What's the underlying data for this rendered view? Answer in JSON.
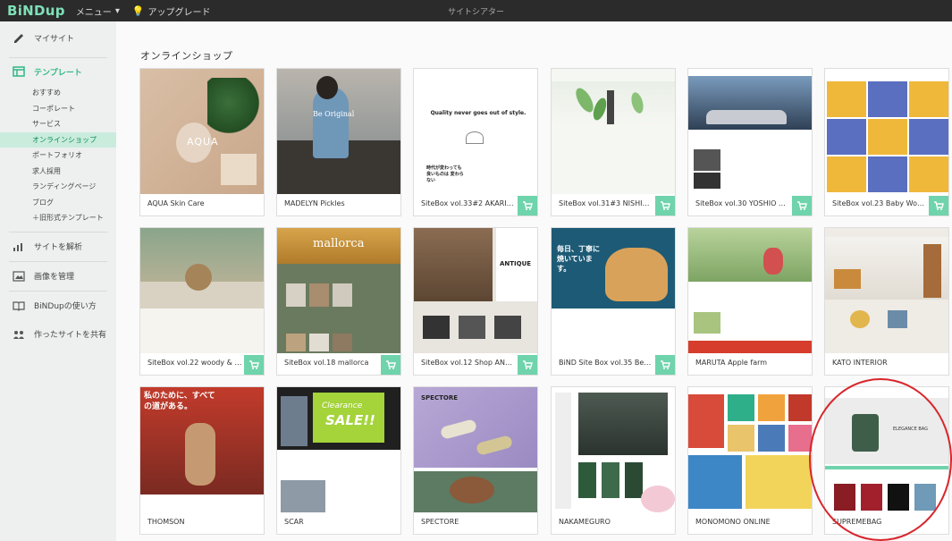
{
  "topbar": {
    "logo_main": "BiND",
    "logo_sub": "up",
    "menu_label": "メニュー",
    "upgrade_label": "アップグレード",
    "site_title": "サイトシアター"
  },
  "sidebar": {
    "items": [
      {
        "label": "マイサイト",
        "icon": "pencil-icon"
      },
      {
        "label": "テンプレート",
        "icon": "template-icon"
      },
      {
        "label": "サイトを解析",
        "icon": "chart-icon"
      },
      {
        "label": "画像を管理",
        "icon": "image-icon"
      },
      {
        "label": "BiNDupの使い方",
        "icon": "book-icon"
      },
      {
        "label": "作ったサイトを共有",
        "icon": "users-icon"
      }
    ],
    "sub_items": [
      "おすすめ",
      "コーポレート",
      "サービス",
      "オンラインショップ",
      "ポートフォリオ",
      "求人採用",
      "ランディングページ",
      "ブログ",
      "＋旧形式テンプレート"
    ],
    "active_sub": 3
  },
  "main": {
    "section_title": "オンラインショップ",
    "cards": [
      {
        "label": "AQUA Skin Care",
        "cart": false
      },
      {
        "label": "MADELYN Pickles",
        "cart": false
      },
      {
        "label": "SiteBox vol.33#2 AKARI…",
        "cart": true
      },
      {
        "label": "SiteBox vol.31#3 NISHI…",
        "cart": true
      },
      {
        "label": "SiteBox vol.30 YOSHIO …",
        "cart": true
      },
      {
        "label": "SiteBox vol.23 Baby Wo…",
        "cart": true
      },
      {
        "label": "SiteBox vol.22 woody & …",
        "cart": true
      },
      {
        "label": "SiteBox vol.18 mallorca",
        "cart": true
      },
      {
        "label": "SiteBox vol.12 Shop AN…",
        "cart": true
      },
      {
        "label": "BiND Site Box vol.35 Be…",
        "cart": true
      },
      {
        "label": "MARUTA Apple farm",
        "cart": false
      },
      {
        "label": "KATO INTERIOR",
        "cart": false
      },
      {
        "label": "THOMSON",
        "cart": false
      },
      {
        "label": "SCAR",
        "cart": false
      },
      {
        "label": "SPECTORE",
        "cart": false
      },
      {
        "label": "NAKAMEGURO",
        "cart": false
      },
      {
        "label": "MONOMONO ONLINE",
        "cart": false
      },
      {
        "label": "SUPREMEBAG",
        "cart": false
      }
    ],
    "thumb_text": {
      "aqua": "AQUA",
      "madelyn": "Be Original",
      "akari": "Quality never goes out of style.",
      "akari_jp": "時代が変わっても 良いものは 変わらない",
      "mallorca": "mallorca",
      "antique": "ANTIQUE",
      "bind35": "毎日、丁寧に焼いています。",
      "thomson": "私のために、すべての道がある。",
      "scar_title": "Clearance",
      "scar_sale": "SALE!!",
      "spectore": "SPECTORE",
      "supreme_bag": "ELEGANCE BAG"
    }
  },
  "colors": {
    "accent": "#2fb884",
    "cart": "#6fd3ac",
    "highlight_ring": "#d8262c"
  }
}
